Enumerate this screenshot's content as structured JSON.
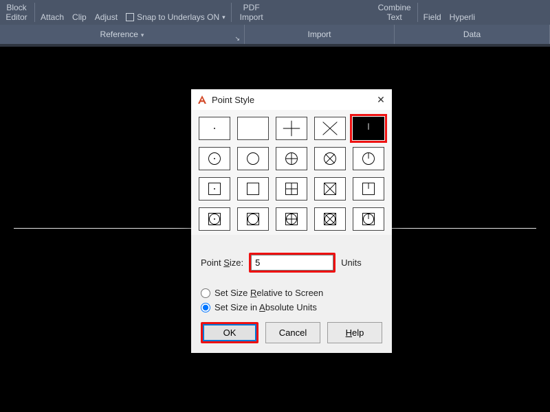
{
  "domain": "Computer-Use",
  "ribbon": {
    "items": {
      "block_editor_l1": "Block",
      "block_editor_l2": "Editor",
      "attach": "Attach",
      "clip": "Clip",
      "adjust": "Adjust",
      "snap": "Snap to Underlays ON",
      "pdf_l1": "PDF",
      "pdf_l2": "Import",
      "combine_l1": "Combine",
      "combine_l2": "Text",
      "field": "Field",
      "hyperlink": "Hyperli"
    },
    "panels": {
      "reference": "Reference",
      "import": "Import",
      "data": "Data"
    }
  },
  "dialog": {
    "title": "Point Style",
    "selected_style_index": 4,
    "point_size_label": "Point Size:",
    "point_size_accel": "S",
    "point_size_value": "5",
    "units_label": "Units",
    "radio_relative": "Set Size Relative to Screen",
    "radio_relative_accel": "R",
    "radio_absolute": "Set Size in Absolute Units",
    "radio_absolute_accel": "A",
    "selected_radio": "absolute",
    "buttons": {
      "ok": "OK",
      "cancel": "Cancel",
      "help": "Help",
      "help_accel": "H"
    }
  },
  "highlights": {
    "color": "#ee1111",
    "note": "red boxes indicate tutorial highlights"
  }
}
